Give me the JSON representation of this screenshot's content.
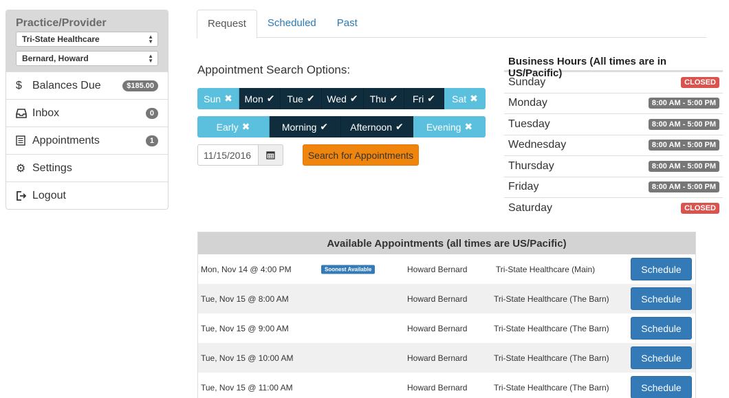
{
  "sidebar": {
    "provider_title": "Practice/Provider",
    "practice_select": "Tri-State Healthcare",
    "provider_select": "Bernard, Howard",
    "items": [
      {
        "label": "Balances Due",
        "badge": "$185.00",
        "icon": "dollar-icon"
      },
      {
        "label": "Inbox",
        "badge": "0",
        "icon": "inbox-icon"
      },
      {
        "label": "Appointments",
        "badge": "1",
        "icon": "list-icon"
      },
      {
        "label": "Settings",
        "badge": "",
        "icon": "gear-icon"
      },
      {
        "label": "Logout",
        "badge": "",
        "icon": "logout-icon"
      }
    ]
  },
  "tabs": [
    {
      "label": "Request",
      "active": true
    },
    {
      "label": "Scheduled",
      "active": false
    },
    {
      "label": "Past",
      "active": false
    }
  ],
  "search": {
    "heading": "Appointment Search Options:",
    "days": [
      {
        "label": "Sun",
        "on": false
      },
      {
        "label": "Mon",
        "on": true
      },
      {
        "label": "Tue",
        "on": true
      },
      {
        "label": "Wed",
        "on": true
      },
      {
        "label": "Thu",
        "on": true
      },
      {
        "label": "Fri",
        "on": true
      },
      {
        "label": "Sat",
        "on": false
      }
    ],
    "times": [
      {
        "label": "Early",
        "on": false
      },
      {
        "label": "Morning",
        "on": true
      },
      {
        "label": "Afternoon",
        "on": true
      },
      {
        "label": "Evening",
        "on": false
      }
    ],
    "date_value": "11/15/2016",
    "search_button": "Search for Appointments"
  },
  "hours": {
    "title": "Business Hours (All times are in US/Pacific)",
    "rows": [
      {
        "day": "Sunday",
        "hours": "CLOSED",
        "closed": true
      },
      {
        "day": "Monday",
        "hours": "8:00 AM - 5:00 PM",
        "closed": false
      },
      {
        "day": "Tuesday",
        "hours": "8:00 AM - 5:00 PM",
        "closed": false
      },
      {
        "day": "Wednesday",
        "hours": "8:00 AM - 5:00 PM",
        "closed": false
      },
      {
        "day": "Thursday",
        "hours": "8:00 AM - 5:00 PM",
        "closed": false
      },
      {
        "day": "Friday",
        "hours": "8:00 AM - 5:00 PM",
        "closed": false
      },
      {
        "day": "Saturday",
        "hours": "CLOSED",
        "closed": true
      }
    ]
  },
  "available": {
    "title": "Available Appointments (all times are US/Pacific)",
    "rows": [
      {
        "date": "Mon, Nov 14 @ 4:00 PM",
        "badge": "Soonest Available",
        "provider": "Howard Bernard",
        "location": "Tri-State Healthcare (Main)",
        "button": "Schedule"
      },
      {
        "date": "Tue, Nov 15 @ 8:00 AM",
        "badge": "",
        "provider": "Howard Bernard",
        "location": "Tri-State Healthcare (The Barn)",
        "button": "Schedule"
      },
      {
        "date": "Tue, Nov 15 @ 9:00 AM",
        "badge": "",
        "provider": "Howard Bernard",
        "location": "Tri-State Healthcare (The Barn)",
        "button": "Schedule"
      },
      {
        "date": "Tue, Nov 15 @ 10:00 AM",
        "badge": "",
        "provider": "Howard Bernard",
        "location": "Tri-State Healthcare (The Barn)",
        "button": "Schedule"
      },
      {
        "date": "Tue, Nov 15 @ 11:00 AM",
        "badge": "",
        "provider": "Howard Bernard",
        "location": "Tri-State Healthcare (The Barn)",
        "button": "Schedule"
      }
    ]
  },
  "colors": {
    "toggle_on": "#0f2d3d",
    "toggle_off": "#5bc0de",
    "search_button": "#f0850d",
    "schedule_button": "#337ab7",
    "closed_badge": "#d9534f",
    "hours_badge": "#777777"
  }
}
